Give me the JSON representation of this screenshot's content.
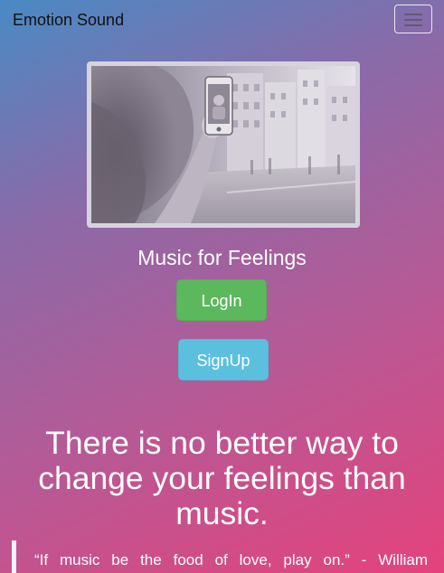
{
  "navbar": {
    "brand": "Emotion Sound",
    "menu_icon": "hamburger-menu-icon"
  },
  "hero": {
    "image": "woman-taking-selfie-photo"
  },
  "main": {
    "tagline": "Music for Feelings",
    "login_label": "LogIn",
    "signup_label": "SignUp",
    "headline": "There is no better way to change your feelings than music.",
    "quote": "“If music be the food of love, play on.” - William"
  },
  "colors": {
    "gradient_start": "#4a8ac4",
    "gradient_end": "#e5427c",
    "login_button": "#5cb85c",
    "signup_button": "#5bc0de"
  }
}
